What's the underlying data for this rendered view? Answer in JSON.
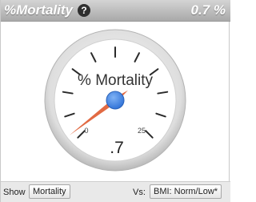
{
  "header": {
    "title": "%Mortality",
    "help_icon": "?",
    "value": "0.7 %"
  },
  "gauge": {
    "label": "% Mortality",
    "min_label": "0",
    "max_label": "25",
    "value_display": ".7",
    "value": 0.7,
    "colors": {
      "needle": "#e26a43",
      "hub": "#3b7fe0",
      "face": "#ffffff",
      "rim": "#cfcfcf"
    }
  },
  "footer": {
    "show_label": "Show",
    "show_button": "Mortality",
    "vs_label": "Vs:",
    "vs_button": "BMI: Norm/Low*"
  }
}
